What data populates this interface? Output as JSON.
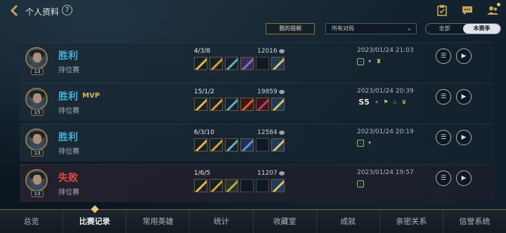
{
  "header": {
    "title": "个人资料",
    "help": "?"
  },
  "filters": {
    "my_video": "我的视频",
    "mode_selected": "所有对局",
    "season_tabs": [
      "全部",
      "本赛季"
    ],
    "active_season_tab": 1
  },
  "matches": [
    {
      "result": "胜利",
      "outcome": "win",
      "mvp": "",
      "mode": "排位赛",
      "level": "13",
      "kda": "4/3/8",
      "gold": "12016",
      "date": "2023/01/24 21:03"
    },
    {
      "result": "胜利",
      "outcome": "win",
      "mvp": "MVP",
      "mode": "排位赛",
      "level": "15",
      "kda": "15/1/2",
      "gold": "19859",
      "date": "2023/01/24 20:39",
      "rank": "S5"
    },
    {
      "result": "胜利",
      "outcome": "win",
      "mvp": "",
      "mode": "排位赛",
      "level": "13",
      "kda": "6/3/10",
      "gold": "12584",
      "date": "2023/01/24 20:19"
    },
    {
      "result": "失败",
      "outcome": "lose",
      "mvp": "",
      "mode": "排位赛",
      "level": "13",
      "kda": "1/6/5",
      "gold": "11207",
      "date": "2023/01/24 19:57"
    }
  ],
  "nav": [
    "总览",
    "比赛记录",
    "常用英雄",
    "统计",
    "收藏室",
    "成就",
    "亲密关系",
    "信誉系统"
  ],
  "nav_active": 1,
  "colors": {
    "accent_gold": "#c9a35a",
    "win": "#3fb2d8",
    "lose": "#e2493f"
  }
}
